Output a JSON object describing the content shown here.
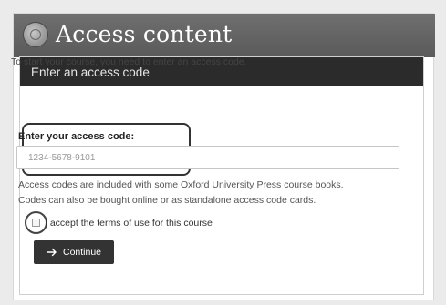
{
  "window": {
    "title": "Access content",
    "logo_icon": "circular-logo-icon"
  },
  "panel": {
    "header": "Enter an access code",
    "intro": "To start your course, you need to enter an access code.",
    "code_label": "Enter your access code:",
    "code_placeholder": "1234-5678-9101",
    "help_line1": "Access codes are included with some Oxford University Press course books.",
    "help_line2": "Codes can also be bought online or as standalone access code cards.",
    "terms_label": "I accept the terms of use for this course",
    "terms_checked": false,
    "continue_label": "Continue",
    "continue_icon": "arrow-right-icon"
  },
  "colors": {
    "title_bar": "#646464",
    "panel_header": "#2b2b2b",
    "button": "#333333"
  }
}
